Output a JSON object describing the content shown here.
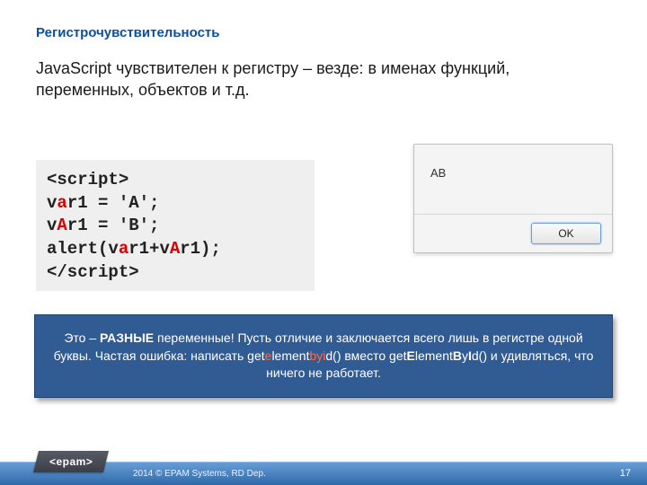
{
  "title": "Регистрочувствительность",
  "subtitle": "JavaScript чувствителен к регистру – везде: в именах функций, переменных, объектов и т.д.",
  "code": {
    "open_tag": "<script>",
    "line1": {
      "pre": " v",
      "hl": "a",
      "post": "r1 = 'A';"
    },
    "line2": {
      "pre": " v",
      "hl": "A",
      "post": "r1 = 'B';"
    },
    "line3": {
      "p1": " alert(v",
      "h1": "a",
      "p2": "r1+v",
      "h2": "A",
      "p3": "r1);"
    },
    "close_tag": "</script>"
  },
  "dialog": {
    "message": "AB",
    "ok": "OK"
  },
  "callout": {
    "p1": "Это – ",
    "strong1": "РАЗНЫЕ",
    "p2": " переменные! Пусть отличие и заключается всего лишь в регистре одной буквы. Частая ошибка: написать get",
    "w1a": "e",
    "w1b": "lement",
    "w1c": "by",
    "w1d": "i",
    "w1e": "d()",
    "p3": " вместо get",
    "w2a": "E",
    "w2b": "lement",
    "w2c": "B",
    "w2d": "y",
    "w2e": "I",
    "w2f": "d()",
    "p4": " и удивляться, что ничего не работает."
  },
  "footer": {
    "logo": "<epam>",
    "copyright": "2014 © EPAM Systems, RD Dep.",
    "page": "17"
  }
}
